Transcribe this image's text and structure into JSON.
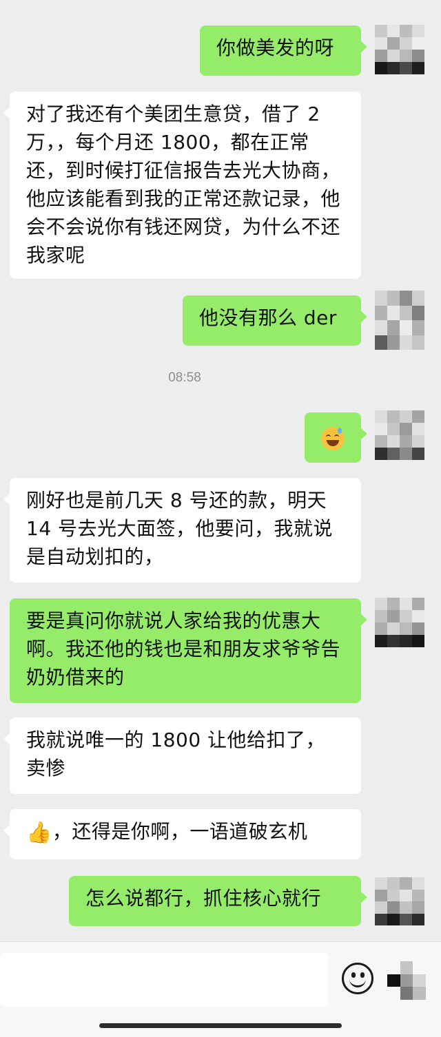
{
  "chat": {
    "messages": [
      {
        "side": "out",
        "text": "你做美发的呀"
      },
      {
        "side": "in",
        "text": "对了我还有个美团生意贷，借了 2 万，，每个月还 1800，都在正常还，到时候打征信报告去光大协商，他应该能看到我的正常还款记录，他会不会说你有钱还网贷，为什么不还我家呢"
      },
      {
        "side": "out",
        "text": "他没有那么 der"
      },
      {
        "side": "out",
        "emoji": "sweat-laugh-emoji"
      },
      {
        "side": "in",
        "text": "刚好也是前几天 8 号还的款，明天 14 号去光大面签，他要问，我就说是自动划扣的，"
      },
      {
        "side": "out",
        "text": "要是真问你就说人家给我的优惠大啊。我还他的钱也是和朋友求爷爷告奶奶借来的"
      },
      {
        "side": "in",
        "text": "我就说唯一的 1800 让他给扣了，卖惨"
      },
      {
        "side": "in",
        "emoji": "thumbs-up-emoji",
        "text": "，还得是你啊，一语道破玄机"
      },
      {
        "side": "out",
        "text": "怎么说都行，抓住核心就行"
      }
    ],
    "timestamp": "08:58"
  },
  "colors": {
    "background": "#ededed",
    "incoming_bubble": "#ffffff",
    "outgoing_bubble": "#95ec69",
    "timestamp": "#8e8e8e"
  },
  "input_bar": {
    "emoji_button_icon": "smile-icon",
    "more_button_icon": "plus-icon"
  }
}
